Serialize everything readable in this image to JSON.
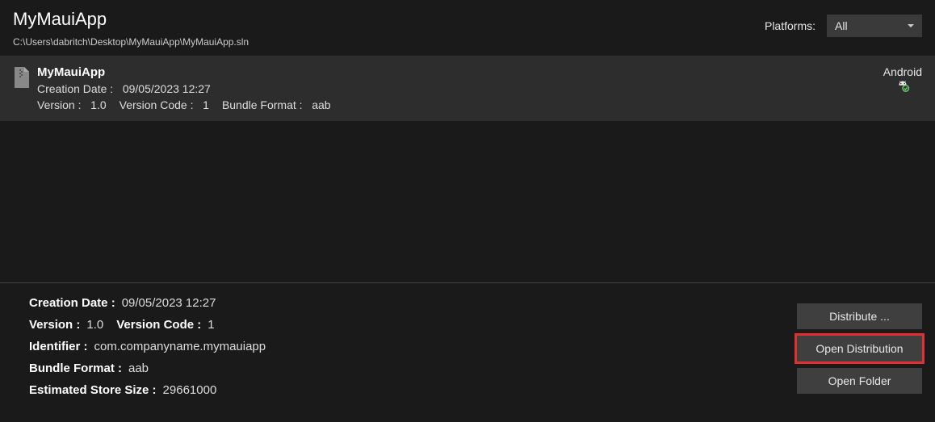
{
  "header": {
    "title": "MyMauiApp",
    "solution_path": "C:\\Users\\dabritch\\Desktop\\MyMauiApp\\MyMauiApp.sln",
    "platforms_label": "Platforms:",
    "platforms_selected": "All"
  },
  "archive": {
    "icon": "file-archive-icon",
    "name": "MyMauiApp",
    "creation_date_label": "Creation Date :",
    "creation_date_value": "09/05/2023 12:27",
    "version_label": "Version :",
    "version_value": "1.0",
    "version_code_label": "Version Code :",
    "version_code_value": "1",
    "bundle_format_label": "Bundle Format :",
    "bundle_format_value": "aab",
    "platform_name": "Android",
    "platform_icon": "android-icon"
  },
  "details": {
    "creation_date_label": "Creation Date :",
    "creation_date_value": "09/05/2023 12:27",
    "version_label": "Version :",
    "version_value": "1.0",
    "version_code_label": "Version Code :",
    "version_code_value": "1",
    "identifier_label": "Identifier :",
    "identifier_value": "com.companyname.mymauiapp",
    "bundle_format_label": "Bundle Format :",
    "bundle_format_value": "aab",
    "estimated_store_size_label": "Estimated Store Size :",
    "estimated_store_size_value": "29661000"
  },
  "actions": {
    "distribute": "Distribute ...",
    "open_distribution": "Open Distribution",
    "open_folder": "Open Folder"
  }
}
